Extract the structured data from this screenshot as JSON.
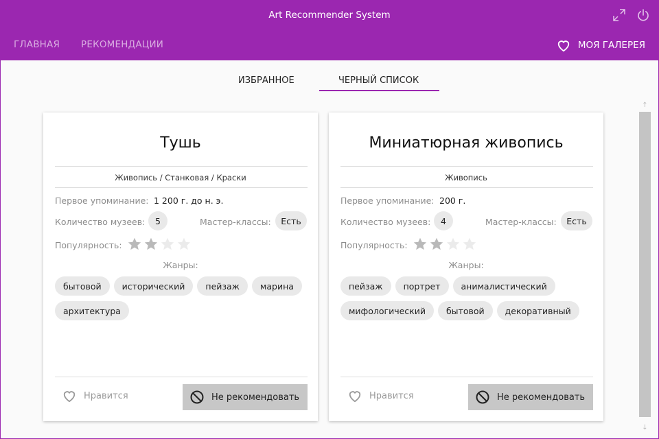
{
  "app": {
    "title": "Art Recommender System"
  },
  "nav": {
    "home": "ГЛАВНАЯ",
    "recommendations": "РЕКОМЕНДАЦИИ",
    "gallery": "МОЯ ГАЛЕРЕЯ"
  },
  "tabs": {
    "favorites": "ИЗБРАННОЕ",
    "blacklist": "ЧЕРНЫЙ СПИСОК",
    "active": "ЧЕРНЫЙ СПИСОК"
  },
  "labels": {
    "first_mention": "Первое упоминание:",
    "museums": "Количество музеев:",
    "masterclasses": "Мастер-классы:",
    "popularity": "Популярность:",
    "genres": "Жанры:",
    "like": "Нравится",
    "block": "Не рекомендовать"
  },
  "cards": [
    {
      "title": "Тушь",
      "path": "Живопись / Станковая / Краски",
      "first_mention": "1 200 г. до н. э.",
      "museums": "5",
      "masterclasses": "Есть",
      "popularity": 2,
      "popularity_max": 4,
      "genres": [
        "бытовой",
        "исторический",
        "пейзаж",
        "марина",
        "архитектура"
      ]
    },
    {
      "title": "Миниатюрная живопись",
      "path": "Живопись",
      "first_mention": "200 г.",
      "museums": "4",
      "masterclasses": "Есть",
      "popularity": 2,
      "popularity_max": 4,
      "genres": [
        "пейзаж",
        "портрет",
        "анималистический",
        "мифологический",
        "бытовой",
        "декоративный"
      ]
    }
  ],
  "colors": {
    "accent": "#9b27b0",
    "background": "#fafafa",
    "chip": "#e9e9e9",
    "star_on": "#b9b9b9",
    "star_off": "#ebebeb"
  }
}
